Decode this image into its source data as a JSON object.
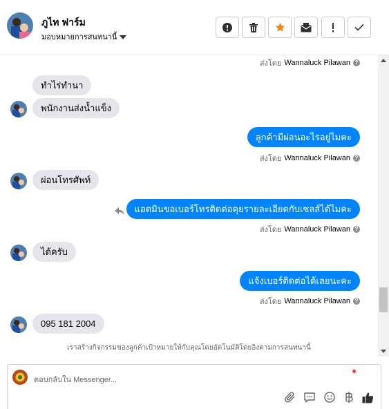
{
  "header": {
    "name": "ภูไท ฟาร์ม",
    "assign_label": "มอบหมายการสนทนานี้",
    "toolbar": [
      "exclamation-circle-icon",
      "trash-icon",
      "star-icon",
      "mark-unread-icon",
      "exclamation-icon",
      "check-icon"
    ]
  },
  "messages": {
    "sent_by_prefix": "ส่งโดย",
    "agent_name": "Wannaluck Pilawan",
    "in1": "ทำไร่ทำนา",
    "in2": "พนักงานส่งน้ำแข็ง",
    "out1": "ลูกค้ามีผ่อนอะไรอยู่ไมคะ",
    "in3": "ผ่อนโทรศัพท์",
    "out2": "แอดมินขอเบอร์โทรติดต่อคุยรายละเอียดกับเซลส์ได้ไมคะ",
    "in4": "ได้ครับ",
    "out3": "แจ้งเบอร์ติดต่อได้เลยนะคะ",
    "in5": "095 181 2004",
    "notice": "เราสร้างกิจกรรมของลูกค้าเป้าหมายให้กับคุณโดยอัตโนมัติโดยอิงตามการสนทนานี้"
  },
  "composer": {
    "placeholder": "ตอบกลับใน Messenger..."
  },
  "colors": {
    "accent": "#0084ff",
    "incoming_bubble": "#e4e6eb",
    "star": "#f5821f"
  }
}
